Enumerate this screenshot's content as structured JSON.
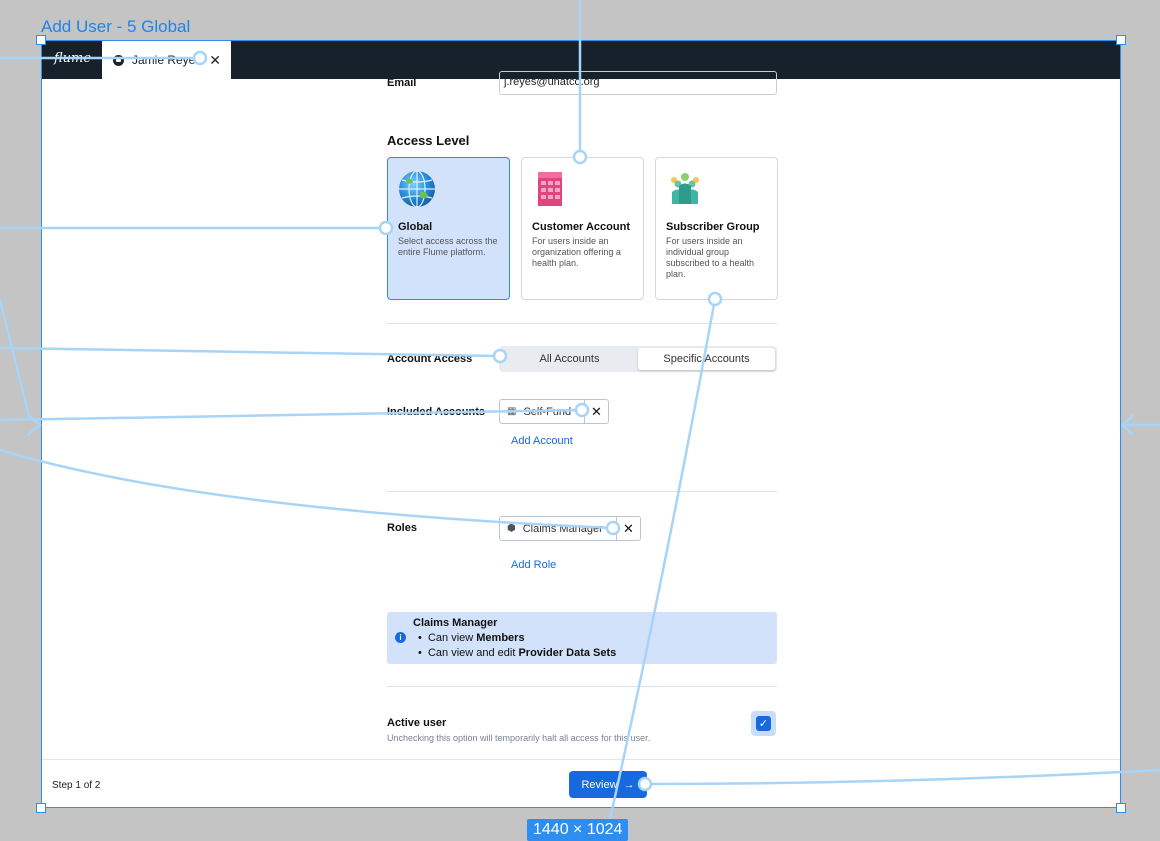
{
  "canvas": {
    "frame_title": "Add User - 5 Global",
    "dimensions_label": "1440 × 1024"
  },
  "topbar": {
    "logo": "flume",
    "tab": {
      "icon": "user-circle-icon",
      "label": "Jamie Reyes",
      "close": "✕"
    }
  },
  "form": {
    "email": {
      "label": "Email",
      "value": "j.reyes@unatco.org"
    },
    "access_level": {
      "title": "Access Level",
      "options": [
        {
          "title": "Global",
          "description": "Select access across the entire Flume platform.",
          "icon": "globe-icon",
          "selected": true
        },
        {
          "title": "Customer Account",
          "description": "For users inside an organization offering a health plan.",
          "icon": "building-icon",
          "selected": false
        },
        {
          "title": "Subscriber Group",
          "description": "For users inside an individual group subscribed to a health plan.",
          "icon": "people-group-icon",
          "selected": false
        }
      ]
    },
    "account_access": {
      "label": "Account Access",
      "options": [
        "All Accounts",
        "Specific Accounts"
      ],
      "selected": "Specific Accounts"
    },
    "included_accounts": {
      "label": "Included Accounts",
      "chips": [
        {
          "label": "Self-Fund",
          "icon": "building-icon"
        }
      ],
      "add_label": "Add Account"
    },
    "roles": {
      "label": "Roles",
      "chips": [
        {
          "label": "Claims Manager",
          "icon": "shield-icon"
        }
      ],
      "add_label": "Add Role"
    },
    "role_info": {
      "title": "Claims Manager",
      "line1_prefix": "Can view ",
      "line1_bold": "Members",
      "line2_prefix": "Can view and edit ",
      "line2_bold": "Provider Data Sets"
    },
    "active_user": {
      "label": "Active user",
      "help": "Unchecking this option will temporarily halt all access for this user.",
      "checked": true
    }
  },
  "footer": {
    "step": "Step 1 of 2",
    "review_label": "Review",
    "review_arrow": "→"
  },
  "colors": {
    "accent": "#1769e0",
    "selection": "#2d8ef0",
    "selected_card_bg": "#d3e2fb",
    "topbar": "#17212b",
    "canvas": "#c4c4c4",
    "wire": "#a8d4f8"
  }
}
